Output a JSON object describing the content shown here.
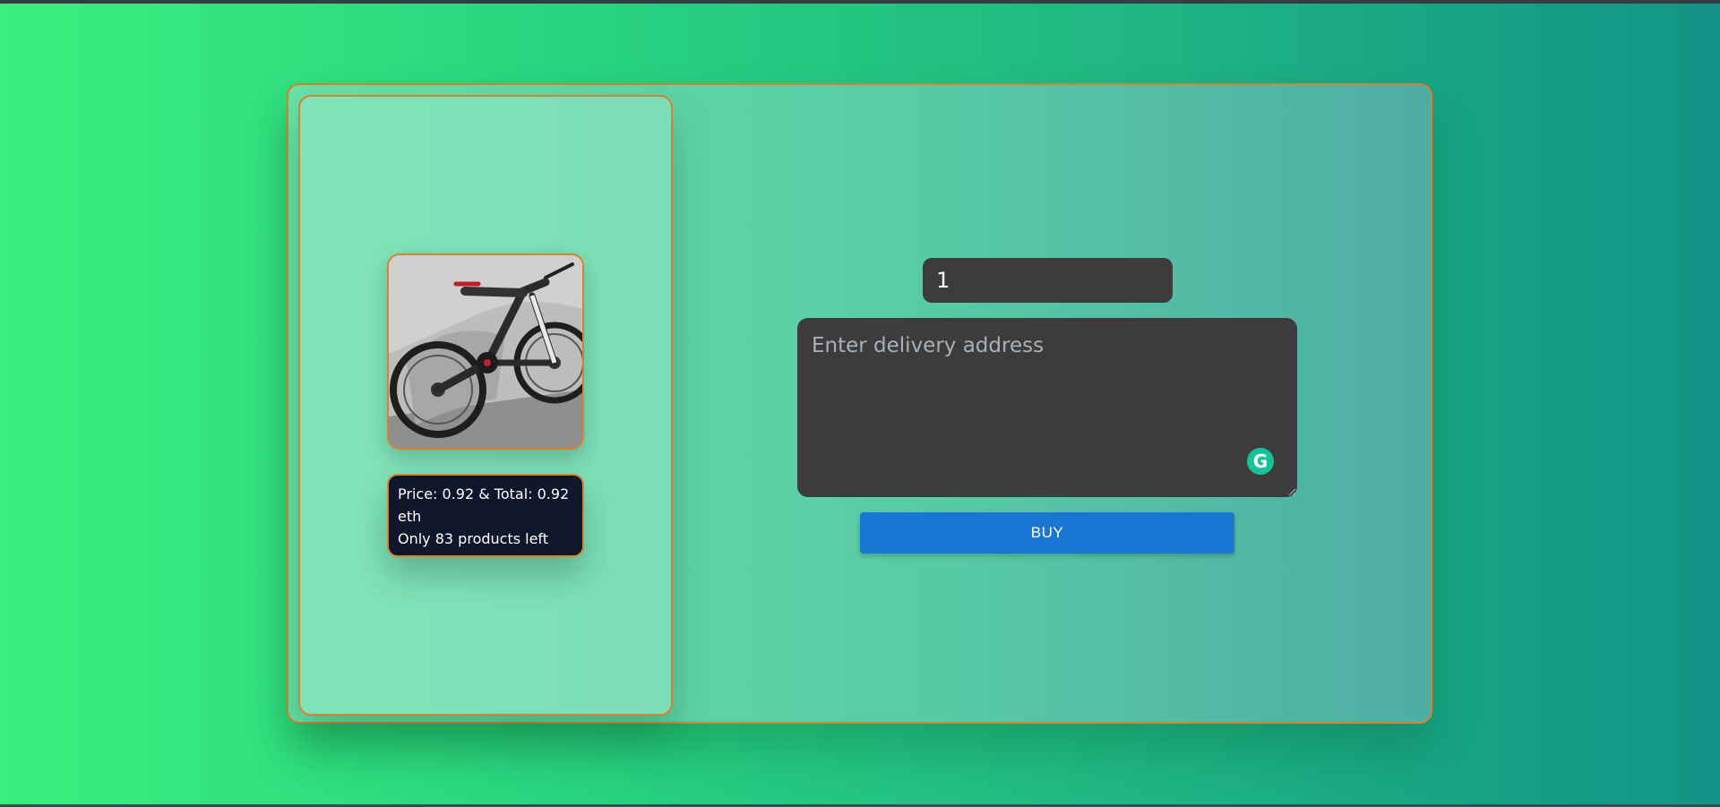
{
  "product": {
    "image_alt": "bicycle-image",
    "price_text": "Price: 0.92 & Total: 0.92",
    "currency_text": "eth",
    "stock_text": "Only 83 products left"
  },
  "form": {
    "quantity_value": "1",
    "address_placeholder": "Enter delivery address",
    "address_value": "",
    "buy_label": "BUY"
  },
  "icons": {
    "grammarly": "grammarly-icon",
    "grammarly_glyph": "G"
  },
  "colors": {
    "accent_border": "#d8822e",
    "button": "#1976d2",
    "input_bg": "#3c3c3c",
    "info_bg": "#11172b"
  }
}
